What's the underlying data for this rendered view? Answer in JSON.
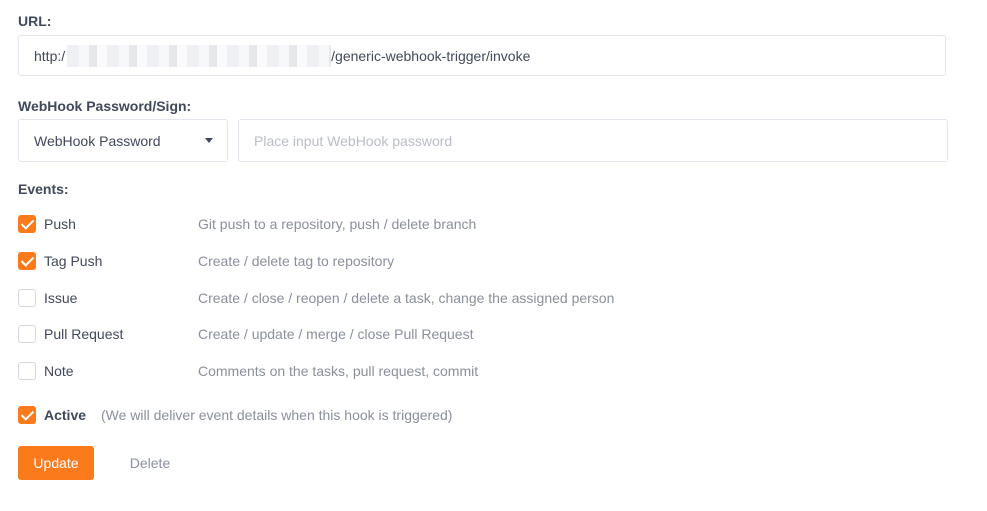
{
  "url": {
    "label": "URL:",
    "prefix": "http:/",
    "suffix": "/generic-webhook-trigger/invoke"
  },
  "password": {
    "label": "WebHook Password/Sign:",
    "type_selected": "WebHook Password",
    "placeholder": "Place input WebHook password",
    "value": ""
  },
  "events": {
    "label": "Events:",
    "items": [
      {
        "name": "Push",
        "description": "Git push to a repository, push / delete branch",
        "checked": true
      },
      {
        "name": "Tag Push",
        "description": "Create / delete tag to repository",
        "checked": true
      },
      {
        "name": "Issue",
        "description": "Create / close / reopen / delete a task, change the assigned person",
        "checked": false
      },
      {
        "name": "Pull Request",
        "description": "Create / update / merge / close Pull Request",
        "checked": false
      },
      {
        "name": "Note",
        "description": "Comments on the tasks, pull request, commit",
        "checked": false
      }
    ]
  },
  "active": {
    "label": "Active",
    "note": "(We will deliver event details when this hook is triggered)",
    "checked": true
  },
  "actions": {
    "update_label": "Update",
    "delete_label": "Delete"
  },
  "colors": {
    "accent": "#fa7a1c",
    "text": "#40485b",
    "muted": "#8a8f9c",
    "border": "#e2e5ec"
  }
}
